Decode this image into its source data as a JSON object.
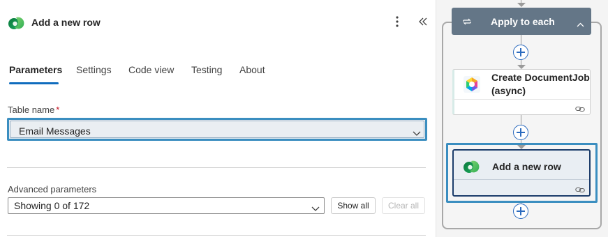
{
  "panel": {
    "title": "Add a new row",
    "icon": "dataverse-icon",
    "more_icon": "more-vertical-icon",
    "collapse_icon": "double-chevron-left-icon"
  },
  "tabs": [
    {
      "label": "Parameters",
      "active": true
    },
    {
      "label": "Settings",
      "active": false
    },
    {
      "label": "Code view",
      "active": false
    },
    {
      "label": "Testing",
      "active": false
    },
    {
      "label": "About",
      "active": false
    }
  ],
  "table_name": {
    "label": "Table name",
    "required_mark": "*",
    "value": "Email Messages"
  },
  "advanced": {
    "label": "Advanced parameters",
    "value": "Showing 0 of 172",
    "show_all": "Show all",
    "clear_all": "Clear all"
  },
  "flow": {
    "apply_each": {
      "label": "Apply to each",
      "icon": "loop-icon",
      "chevron_icon": "chevron-up-icon"
    },
    "create_doc": {
      "title_line1": "Create DocumentJob",
      "title_line2": "(async)",
      "icon": "document-job-icon"
    },
    "add_row": {
      "title": "Add a new row",
      "icon": "dataverse-icon"
    },
    "link_icon": "link-icon",
    "plus_icon": "plus-icon"
  },
  "colors": {
    "accent": "#0f6cbd",
    "selection": "#3b8ec0",
    "apply_header": "#647687",
    "card_border_selected": "#1c3d6b",
    "required": "#c50f1f"
  }
}
